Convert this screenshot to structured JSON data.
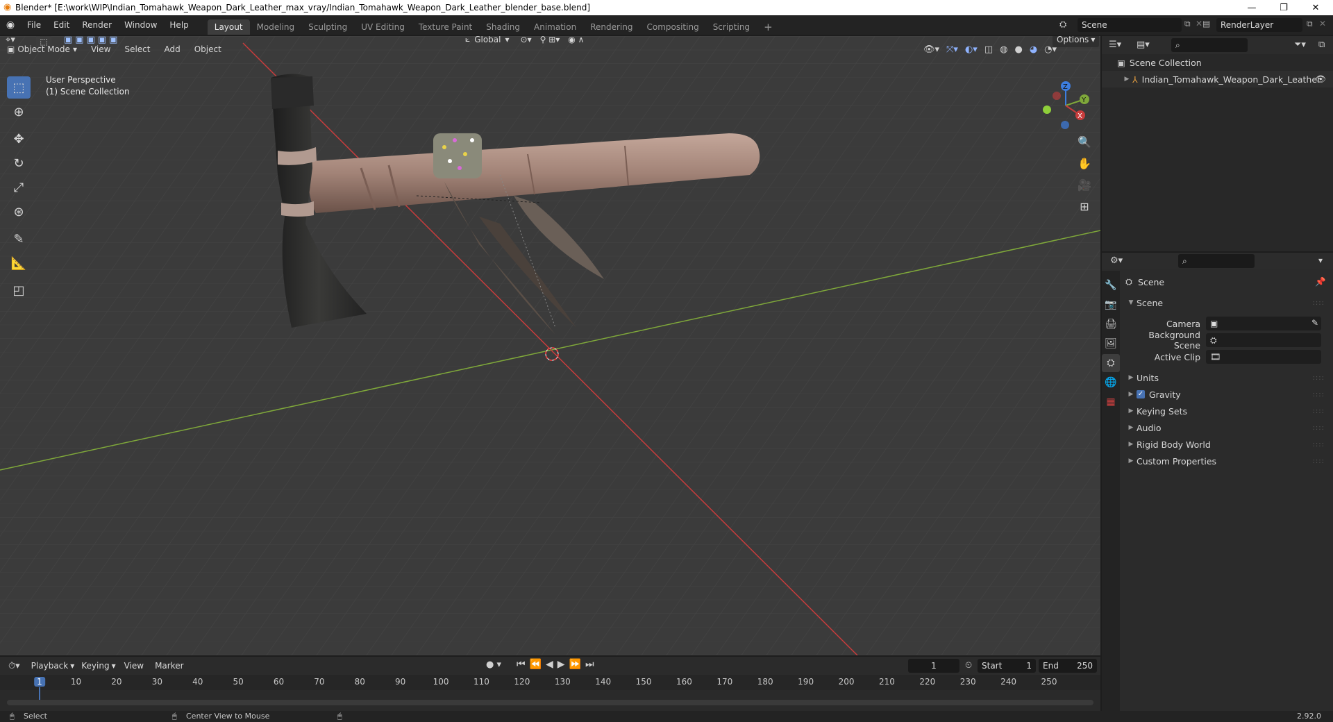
{
  "window": {
    "title": "Blender* [E:\\work\\WIP\\Indian_Tomahawk_Weapon_Dark_Leather_max_vray/Indian_Tomahawk_Weapon_Dark_Leather_blender_base.blend]",
    "minimize": "—",
    "maximize": "❐",
    "close": "✕"
  },
  "menu": [
    "File",
    "Edit",
    "Render",
    "Window",
    "Help"
  ],
  "workspaces": [
    "Layout",
    "Modeling",
    "Sculpting",
    "UV Editing",
    "Texture Paint",
    "Shading",
    "Animation",
    "Rendering",
    "Compositing",
    "Scripting"
  ],
  "active_workspace": "Layout",
  "scene_field": "Scene",
  "renderlayer_field": "RenderLayer",
  "viewport": {
    "mode": "Object Mode",
    "menus": [
      "View",
      "Select",
      "Add",
      "Object"
    ],
    "transform_orientation": "Global",
    "options": "Options",
    "overlay_line1": "User Perspective",
    "overlay_line2": "(1) Scene Collection",
    "gizmo": {
      "x": "X",
      "y": "Y",
      "z": "Z"
    }
  },
  "outliner": {
    "collection": "Scene Collection",
    "object": "Indian_Tomahawk_Weapon_Dark_Leather"
  },
  "properties": {
    "context": "Scene",
    "panel_title": "Scene",
    "camera_label": "Camera",
    "background_scene_label": "Background Scene",
    "active_clip_label": "Active Clip",
    "subpanels": [
      "Units",
      "Gravity",
      "Keying Sets",
      "Audio",
      "Rigid Body World",
      "Custom Properties"
    ],
    "gravity_checked": true
  },
  "timeline": {
    "menus": [
      "Playback",
      "Keying",
      "View",
      "Marker"
    ],
    "current_frame": "1",
    "start_label": "Start",
    "start": "1",
    "end_label": "End",
    "end": "250",
    "ruler": [
      "1",
      "10",
      "20",
      "30",
      "40",
      "50",
      "60",
      "70",
      "80",
      "90",
      "100",
      "110",
      "120",
      "130",
      "140",
      "150",
      "160",
      "170",
      "180",
      "190",
      "200",
      "210",
      "220",
      "230",
      "240",
      "250"
    ]
  },
  "status": {
    "select": "Select",
    "center_view": "Center View to Mouse",
    "version": "2.92.0"
  },
  "colors": {
    "accent": "#4772b3",
    "x_axis": "#c83c3c",
    "y_axis": "#7fa83a",
    "z_axis": "#3d7ee0"
  }
}
